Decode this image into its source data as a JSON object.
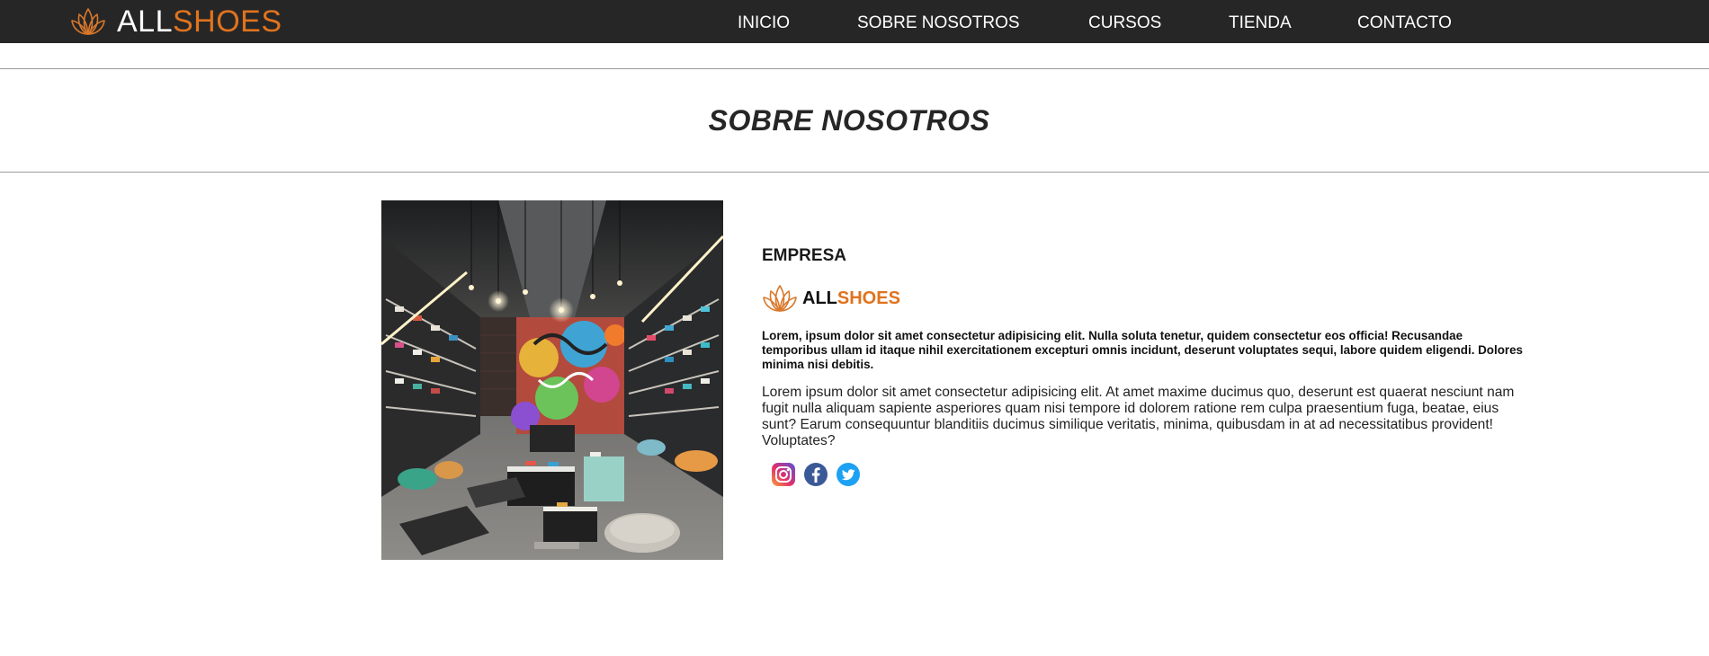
{
  "header": {
    "brand": {
      "part1": "ALL",
      "part2": "SHOES",
      "logo_icon": "lotus-icon"
    },
    "nav": [
      {
        "label": "INICIO"
      },
      {
        "label": "SOBRE NOSOTROS"
      },
      {
        "label": "CURSOS"
      },
      {
        "label": "TIENDA"
      },
      {
        "label": "CONTACTO"
      }
    ]
  },
  "page": {
    "title": "SOBRE NOSOTROS"
  },
  "about": {
    "image_subject": "sneaker store interior with graffiti wall",
    "heading": "EMPRESA",
    "company": {
      "part1": "ALL",
      "part2": "SHOES",
      "logo_icon": "lotus-icon"
    },
    "lead": "Lorem, ipsum dolor sit amet consectetur adipisicing elit. Nulla soluta tenetur, quidem consectetur eos officia! Recusandae temporibus ullam id itaque nihil exercitationem excepturi omnis incidunt, deserunt voluptates sequi, labore quidem eligendi. Dolores minima nisi debitis.",
    "body": "Lorem ipsum dolor sit amet consectetur adipisicing elit. At amet maxime ducimus quo, deserunt est quaerat nesciunt nam fugit nulla aliquam sapiente asperiores quam nisi tempore id dolorem ratione rem culpa praesentium fuga, beatae, eius sunt? Earum consequuntur blanditiis ducimus similique veritatis, minima, quibusdam in at ad necessitatibus provident! Voluptates?",
    "social": [
      {
        "icon": "instagram-icon"
      },
      {
        "icon": "facebook-icon"
      },
      {
        "icon": "twitter-icon"
      }
    ]
  },
  "colors": {
    "navbar_bg": "#262626",
    "accent_orange": "#e0731e",
    "title_text": "#262626"
  }
}
